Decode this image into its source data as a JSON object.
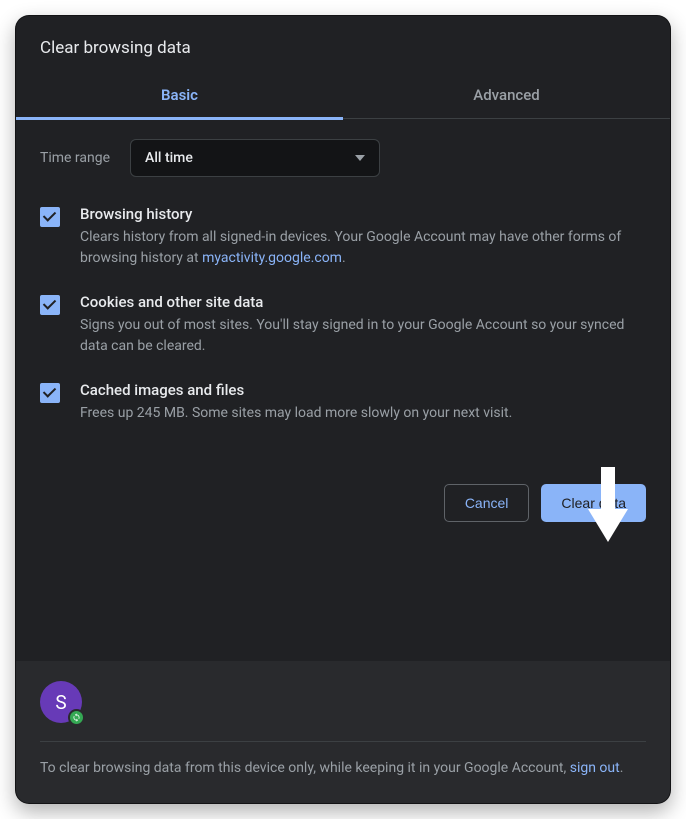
{
  "title": "Clear browsing data",
  "tabs": {
    "basic": "Basic",
    "advanced": "Advanced"
  },
  "timeRange": {
    "label": "Time range",
    "value": "All time"
  },
  "options": {
    "history": {
      "title": "Browsing history",
      "desc_before": "Clears history from all signed-in devices. Your Google Account may have other forms of browsing history at ",
      "link": "myactivity.google.com",
      "desc_after": "."
    },
    "cookies": {
      "title": "Cookies and other site data",
      "desc": "Signs you out of most sites. You'll stay signed in to your Google Account so your synced data can be cleared."
    },
    "cache": {
      "title": "Cached images and files",
      "desc": "Frees up 245 MB. Some sites may load more slowly on your next visit."
    }
  },
  "buttons": {
    "cancel": "Cancel",
    "clear": "Clear data"
  },
  "avatar": {
    "initial": "S"
  },
  "footer": {
    "text_before": "To clear browsing data from this device only, while keeping it in your Google Account, ",
    "link": "sign out",
    "text_after": "."
  }
}
